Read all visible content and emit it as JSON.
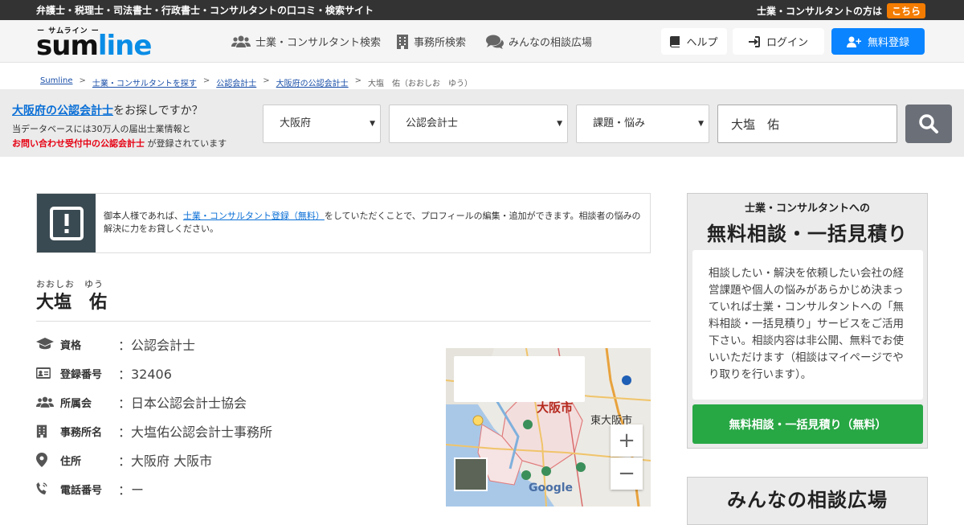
{
  "topbar": {
    "tagline": "弁護士・税理士・司法書士・行政書士・コンサルタントの口コミ・検索サイト",
    "pro_text": "士業・コンサルタントの方は",
    "pro_link": "こちら"
  },
  "header": {
    "logo_sub": "ー サムライン ー",
    "logo_part1": "sum",
    "logo_part2": "line",
    "nav": [
      {
        "label": "士業・コンサルタント検索",
        "icon": "users-icon"
      },
      {
        "label": "事務所検索",
        "icon": "building-icon"
      },
      {
        "label": "みんなの相談広場",
        "icon": "comments-icon"
      }
    ],
    "help": "ヘルプ",
    "login": "ログイン",
    "register": "無料登録"
  },
  "breadcrumb": {
    "items": [
      "Sumline",
      "士業・コンサルタントを探す",
      "公認会計士",
      "大阪府の公認会計士"
    ],
    "current": "大塩　佑（おおしお　ゆう）"
  },
  "search": {
    "line1_link": "大阪府の公認会計士",
    "line1_rest": "をお探しですか？",
    "line2": "当データベースには30万人の届出士業情報と",
    "line3_red": "お問い合わせ受付中の公認会計士",
    "line3_rest": " が登録されています",
    "pref": "大阪府",
    "profession": "公認会計士",
    "topic": "課題・悩み",
    "keyword": "大塩　佑"
  },
  "notice": {
    "pre": "御本人様であれば、",
    "link": "士業・コンサルタント登録（無料）",
    "post": "をしていただくことで、プロフィールの編集・追加ができます。相談者の悩みの解決に力をお貸しください。"
  },
  "profile": {
    "ruby": "おおしお　ゆう",
    "name": "大塩　佑",
    "rows": [
      {
        "icon": "graduation-cap-icon",
        "key": "資格",
        "value": "：公認会計士"
      },
      {
        "icon": "id-card-icon",
        "key": "登録番号",
        "value": "：32406"
      },
      {
        "icon": "users-icon",
        "key": "所属会",
        "value": "：日本公認会計士協会"
      },
      {
        "icon": "building-icon",
        "key": "事務所名",
        "value": "：大塩佑公認会計士事務所"
      },
      {
        "icon": "map-marker-icon",
        "key": "住所",
        "value": "：大阪府 大阪市"
      },
      {
        "icon": "phone-icon",
        "key": "電話番号",
        "value": "：ー"
      }
    ]
  },
  "map": {
    "city": "大阪市",
    "east": "東大阪市",
    "google": "Google",
    "zoom_in": "+",
    "zoom_out": "−"
  },
  "sidebar": {
    "card1_sub": "士業・コンサルタントへの",
    "card1_title": "無料相談・一括見積り",
    "card1_body": "相談したい・解決を依頼したい会社の経営課題や個人の悩みがあらかじめ決まっていれば士業・コンサルタントへの「無料相談・一括見積り」サービスをご活用下さい。相談内容は非公開、無料でお使いいただけます（相談はマイページでやり取りを行います）。",
    "card1_button": "無料相談・一括見積り（無料）",
    "card2_title": "みんなの相談広場"
  },
  "colors": {
    "accent_blue": "#0a84ff",
    "link_blue": "#0a6fd6",
    "green_button": "#28a745",
    "orange_badge": "#f47c00",
    "red_text": "#e60012"
  }
}
